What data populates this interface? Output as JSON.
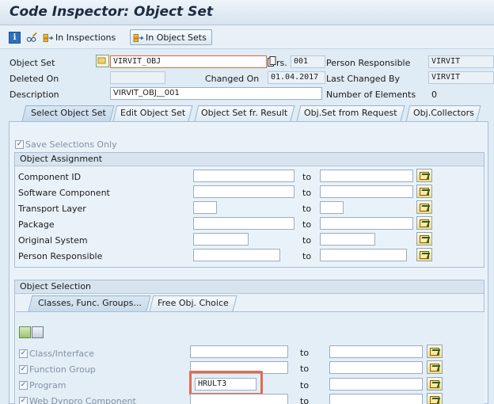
{
  "window": {
    "title": "Code Inspector: Object Set"
  },
  "toolbar": {
    "info_icon_glyph": "i",
    "in_inspections": "In Inspections",
    "in_object_sets": "In Object Sets"
  },
  "header": {
    "object_set_label": "Object Set",
    "object_set_value": "VIRVIT_OBJ",
    "version_label": "rs.",
    "version_value": "001",
    "person_responsible_label": "Person Responsible",
    "person_responsible_value": "VIRVIT",
    "deleted_on_label": "Deleted On",
    "deleted_on_value": "",
    "changed_on_label": "Changed On",
    "changed_on_value": "01.04.2017",
    "last_changed_by_label": "Last Changed By",
    "last_changed_by_value": "VIRVIT",
    "description_label": "Description",
    "description_value": "VIRVIT_OBJ__001",
    "num_elements_label": "Number of Elements",
    "num_elements_value": "0"
  },
  "tabs": [
    {
      "label": "Select Object Set",
      "active": true
    },
    {
      "label": "Edit Object Set",
      "active": false
    },
    {
      "label": "Object Set fr. Result",
      "active": false
    },
    {
      "label": "Obj.Set from Request",
      "active": false
    },
    {
      "label": "Obj.Collectors",
      "active": false
    }
  ],
  "save_selections_only": {
    "label": "Save Selections Only",
    "checked": true
  },
  "object_assignment": {
    "title": "Object Assignment",
    "to_label": "to",
    "rows": [
      {
        "label": "Component ID",
        "from": "",
        "to": ""
      },
      {
        "label": "Software Component",
        "from": "",
        "to": ""
      },
      {
        "label": "Transport Layer",
        "from": "",
        "to": ""
      },
      {
        "label": "Package",
        "from": "",
        "to": ""
      },
      {
        "label": "Original System",
        "from": "",
        "to": ""
      },
      {
        "label": "Person Responsible",
        "from": "",
        "to": ""
      }
    ]
  },
  "object_selection": {
    "title": "Object Selection",
    "subtabs": [
      {
        "label": "Classes, Func. Groups...",
        "active": true
      },
      {
        "label": "Free Obj. Choice",
        "active": false
      }
    ],
    "to_label": "to",
    "rows": [
      {
        "label": "Class/Interface",
        "checked": true,
        "from": "",
        "to": ""
      },
      {
        "label": "Function Group",
        "checked": true,
        "from": "",
        "to": ""
      },
      {
        "label": "Program",
        "checked": true,
        "from": "HRULT3",
        "to": ""
      },
      {
        "label": "Web Dynpro Component",
        "checked": true,
        "from": "",
        "to": ""
      }
    ]
  },
  "colors": {
    "title_text": "#1c2c40",
    "highlight_box": "#e06b50",
    "panel_bg": "#eaf2f9"
  }
}
